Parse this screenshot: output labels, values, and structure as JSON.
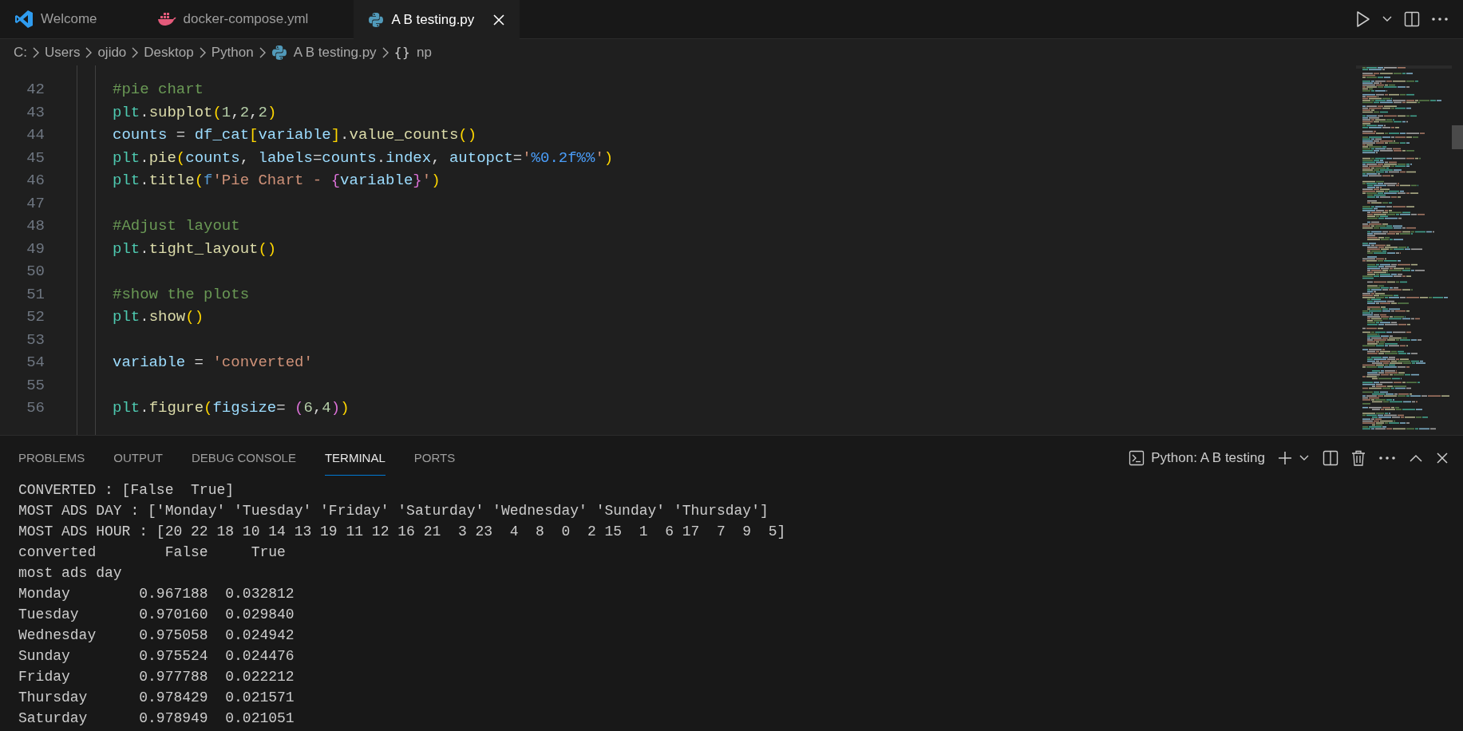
{
  "tabs": [
    {
      "label": "Welcome",
      "kind": "welcome",
      "selected": false
    },
    {
      "label": "docker-compose.yml",
      "kind": "docker",
      "selected": false
    },
    {
      "label": "A B testing.py",
      "kind": "python",
      "selected": true
    }
  ],
  "breadcrumb": [
    {
      "label": "C:",
      "kind": "folder"
    },
    {
      "label": "Users",
      "kind": "folder"
    },
    {
      "label": "ojido",
      "kind": "folder"
    },
    {
      "label": "Desktop",
      "kind": "folder"
    },
    {
      "label": "Python",
      "kind": "folder"
    },
    {
      "label": "A B testing.py",
      "kind": "file"
    },
    {
      "label": "np",
      "kind": "symbol",
      "symbol": "{}"
    }
  ],
  "editor": {
    "lines": [
      {
        "number": "42",
        "tokens": [
          {
            "kind": "cm",
            "text": "#pie chart"
          }
        ]
      },
      {
        "number": "43",
        "tokens": [
          {
            "kind": "cls",
            "text": "plt"
          },
          {
            "kind": "op",
            "text": "."
          },
          {
            "kind": "fn",
            "text": "subplot"
          },
          {
            "kind": "b1",
            "text": "("
          },
          {
            "kind": "num",
            "text": "1"
          },
          {
            "kind": "op",
            "text": ","
          },
          {
            "kind": "num",
            "text": "2"
          },
          {
            "kind": "op",
            "text": ","
          },
          {
            "kind": "num",
            "text": "2"
          },
          {
            "kind": "b1",
            "text": ")"
          }
        ]
      },
      {
        "number": "44",
        "tokens": [
          {
            "kind": "var",
            "text": "counts"
          },
          {
            "kind": "op",
            "text": " = "
          },
          {
            "kind": "var",
            "text": "df_cat"
          },
          {
            "kind": "b1",
            "text": "["
          },
          {
            "kind": "var",
            "text": "variable"
          },
          {
            "kind": "b1",
            "text": "]"
          },
          {
            "kind": "op",
            "text": "."
          },
          {
            "kind": "fn",
            "text": "value_counts"
          },
          {
            "kind": "b1",
            "text": "()"
          }
        ]
      },
      {
        "number": "45",
        "tokens": [
          {
            "kind": "cls",
            "text": "plt"
          },
          {
            "kind": "op",
            "text": "."
          },
          {
            "kind": "fn",
            "text": "pie"
          },
          {
            "kind": "b1",
            "text": "("
          },
          {
            "kind": "var",
            "text": "counts"
          },
          {
            "kind": "op",
            "text": ", "
          },
          {
            "kind": "var",
            "text": "labels"
          },
          {
            "kind": "op",
            "text": "="
          },
          {
            "kind": "var",
            "text": "counts"
          },
          {
            "kind": "op",
            "text": "."
          },
          {
            "kind": "var",
            "text": "index"
          },
          {
            "kind": "op",
            "text": ", "
          },
          {
            "kind": "var",
            "text": "autopct"
          },
          {
            "kind": "op",
            "text": "="
          },
          {
            "kind": "str",
            "text": "'"
          },
          {
            "kind": "fmt",
            "text": "%0.2f%%"
          },
          {
            "kind": "str",
            "text": "'"
          },
          {
            "kind": "b1",
            "text": ")"
          }
        ]
      },
      {
        "number": "46",
        "tokens": [
          {
            "kind": "cls",
            "text": "plt"
          },
          {
            "kind": "op",
            "text": "."
          },
          {
            "kind": "fn",
            "text": "title"
          },
          {
            "kind": "b1",
            "text": "("
          },
          {
            "kind": "kw",
            "text": "f"
          },
          {
            "kind": "str",
            "text": "'Pie Chart - "
          },
          {
            "kind": "b2",
            "text": "{"
          },
          {
            "kind": "var",
            "text": "variable"
          },
          {
            "kind": "b2",
            "text": "}"
          },
          {
            "kind": "str",
            "text": "'"
          },
          {
            "kind": "b1",
            "text": ")"
          }
        ]
      },
      {
        "number": "47"
      },
      {
        "number": "48",
        "tokens": [
          {
            "kind": "cm",
            "text": "#Adjust layout"
          }
        ]
      },
      {
        "number": "49",
        "tokens": [
          {
            "kind": "cls",
            "text": "plt"
          },
          {
            "kind": "op",
            "text": "."
          },
          {
            "kind": "fn",
            "text": "tight_layout"
          },
          {
            "kind": "b1",
            "text": "()"
          }
        ]
      },
      {
        "number": "50"
      },
      {
        "number": "51",
        "tokens": [
          {
            "kind": "cm",
            "text": "#show the plots"
          }
        ]
      },
      {
        "number": "52",
        "tokens": [
          {
            "kind": "cls",
            "text": "plt"
          },
          {
            "kind": "op",
            "text": "."
          },
          {
            "kind": "fn",
            "text": "show"
          },
          {
            "kind": "b1",
            "text": "()"
          }
        ]
      },
      {
        "number": "53"
      },
      {
        "number": "54",
        "tokens": [
          {
            "kind": "var",
            "text": "variable"
          },
          {
            "kind": "op",
            "text": " = "
          },
          {
            "kind": "str",
            "text": "'converted'"
          }
        ]
      },
      {
        "number": "55"
      },
      {
        "number": "56",
        "tokens": [
          {
            "kind": "cls",
            "text": "plt"
          },
          {
            "kind": "op",
            "text": "."
          },
          {
            "kind": "fn",
            "text": "figure"
          },
          {
            "kind": "b1",
            "text": "("
          },
          {
            "kind": "var",
            "text": "figsize"
          },
          {
            "kind": "op",
            "text": "= "
          },
          {
            "kind": "b2",
            "text": "("
          },
          {
            "kind": "num",
            "text": "6"
          },
          {
            "kind": "op",
            "text": ","
          },
          {
            "kind": "num",
            "text": "4"
          },
          {
            "kind": "b2",
            "text": ")"
          },
          {
            "kind": "b1",
            "text": ")"
          }
        ]
      }
    ]
  },
  "panel": {
    "tabs": [
      {
        "label": "PROBLEMS",
        "selected": false
      },
      {
        "label": "OUTPUT",
        "selected": false
      },
      {
        "label": "DEBUG CONSOLE",
        "selected": false
      },
      {
        "label": "TERMINAL",
        "selected": true
      },
      {
        "label": "PORTS",
        "selected": false
      }
    ],
    "terminal_name": "Python: A B testing",
    "lines": [
      "CONVERTED : [False  True]",
      "MOST ADS DAY : ['Monday' 'Tuesday' 'Friday' 'Saturday' 'Wednesday' 'Sunday' 'Thursday']",
      "MOST ADS HOUR : [20 22 18 10 14 13 19 11 12 16 21  3 23  4  8  0  2 15  1  6 17  7  9  5]",
      "converted        False     True",
      "most ads day",
      "Monday        0.967188  0.032812",
      "Tuesday       0.970160  0.029840",
      "Wednesday     0.975058  0.024942",
      "Sunday        0.975524  0.024476",
      "Friday        0.977788  0.022212",
      "Thursday      0.978429  0.021571",
      "Saturday      0.978949  0.021051"
    ]
  }
}
